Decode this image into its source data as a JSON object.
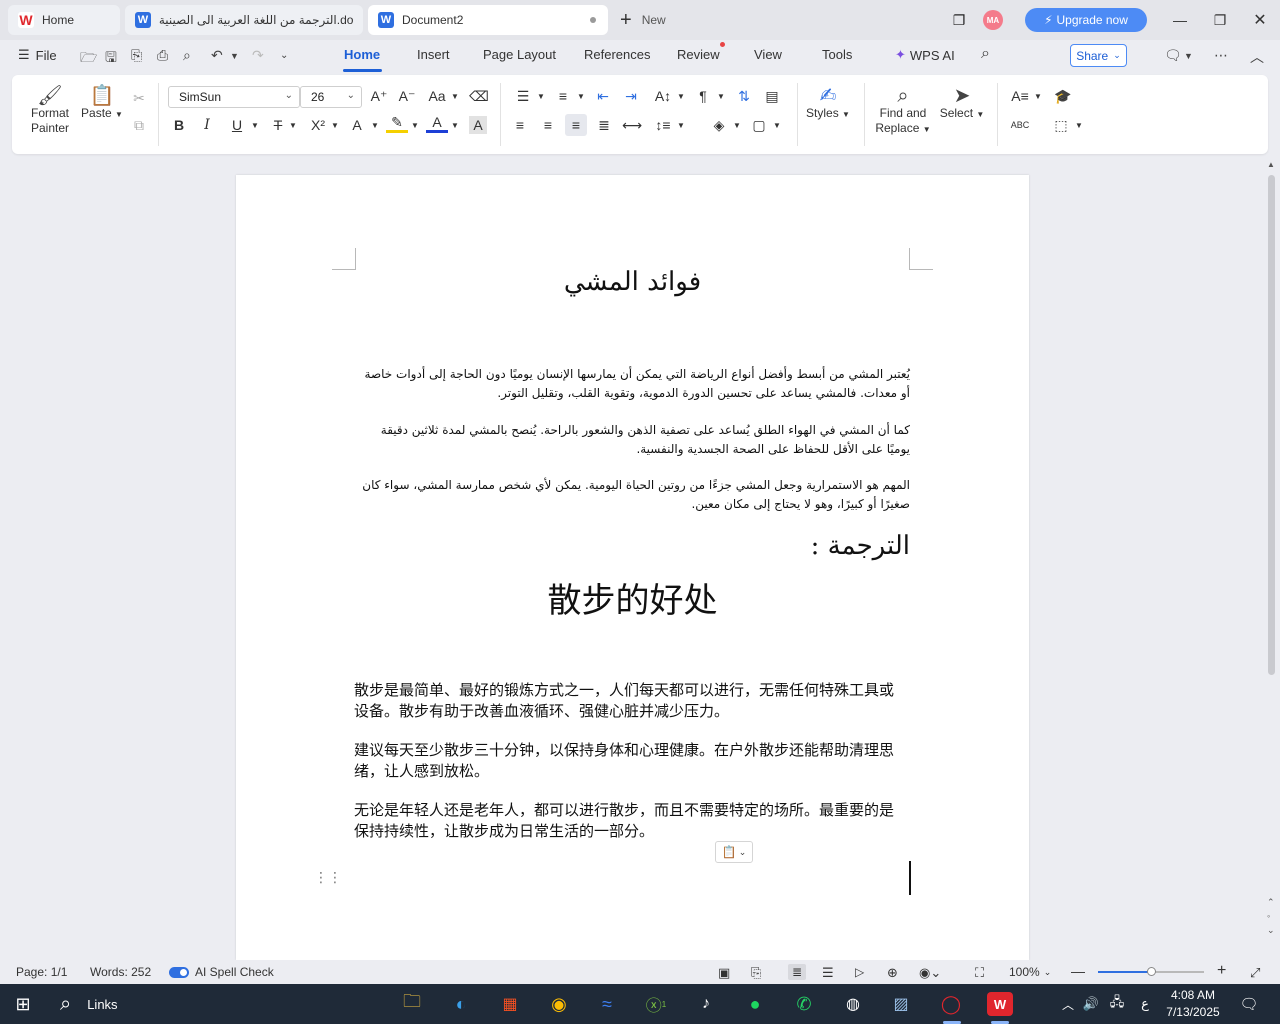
{
  "titlebar": {
    "tabs": [
      {
        "label": "Home",
        "icon": "wps-logo-icon"
      },
      {
        "label": "الترجمة من اللغة العربية الى الصينية.do",
        "icon": "writer-doc-icon"
      },
      {
        "label": "Document2",
        "icon": "writer-doc-icon"
      }
    ],
    "new_label": "New",
    "avatar_initials": "MA",
    "upgrade_label": "Upgrade now"
  },
  "menubar": {
    "file_label": "File",
    "tabs": [
      "Home",
      "Insert",
      "Page Layout",
      "References",
      "Review",
      "View",
      "Tools"
    ],
    "active_tab": "Home",
    "wps_ai_label": "WPS AI",
    "share_label": "Share"
  },
  "ribbon": {
    "format_painter": "Format\nPainter",
    "format_painter_l1": "Format",
    "format_painter_l2": "Painter",
    "paste": "Paste",
    "font_name": "SimSun",
    "font_size": "26",
    "styles": "Styles",
    "find_replace_l1": "Find and",
    "find_replace_l2": "Replace",
    "select": "Select",
    "accent_color": "#1d5fd6"
  },
  "document": {
    "ar_title": "فوائد المشي",
    "ar_paragraphs": [
      "يُعتبر المشي من أبسط وأفضل أنواع الرياضة التي يمكن أن يمارسها الإنسان يوميًا دون الحاجة إلى أدوات خاصة أو معدات. فالمشي يساعد على تحسين الدورة الدموية، وتقوية القلب، وتقليل التوتر.",
      "كما أن المشي في الهواء الطلق يُساعد على تصفية الذهن والشعور بالراحة. يُنصح بالمشي لمدة ثلاثين دقيقة يوميًا على الأقل للحفاظ على الصحة الجسدية والنفسية.",
      "المهم هو الاستمرارية وجعل المشي جزءًا من روتين الحياة اليومية. يمكن لأي شخص ممارسة المشي، سواء كان صغيرًا أو كبيرًا، وهو لا يحتاج إلى مكان معين."
    ],
    "ar_heading": "الترجمة :",
    "cn_title": "散步的好处",
    "cn_paragraphs": [
      "散步是最简单、最好的锻炼方式之一，人们每天都可以进行，无需任何特殊工具或设备。散步有助于改善血液循环、强健心脏并减少压力。",
      "建议每天至少散步三十分钟，以保持身体和心理健康。在户外散步还能帮助清理思绪，让人感到放松。",
      "无论是年轻人还是老年人，都可以进行散步，而且不需要特定的场所。最重要的是保持持续性，让散步成为日常生活的一部分。"
    ]
  },
  "statusbar": {
    "page": "Page: 1/1",
    "words": "Words: 252",
    "spell_check": "AI Spell Check",
    "zoom": "100%",
    "zoom_level": 0.5
  },
  "taskbar": {
    "search_label": "Links",
    "time": "4:08 AM",
    "date": "7/13/2025",
    "lang": "ع",
    "xbox_badge": "1"
  }
}
